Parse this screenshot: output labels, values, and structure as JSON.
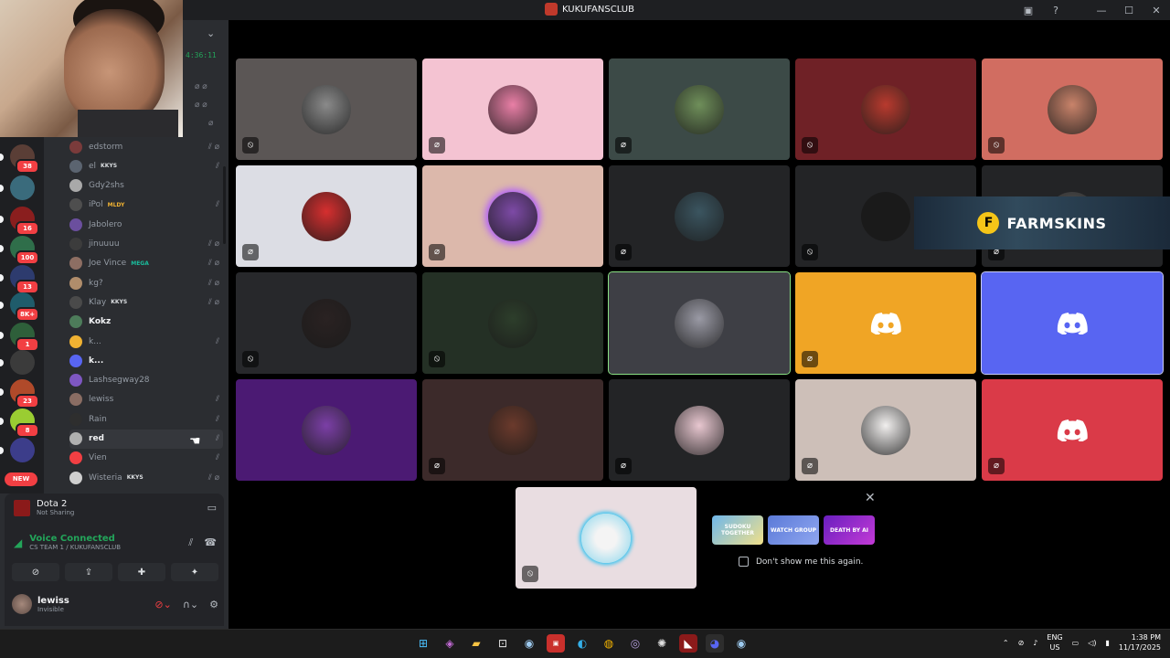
{
  "window": {
    "title": "KUKUFANSCLUB"
  },
  "timer": "4:36:11",
  "servers": [
    {
      "badge": "38",
      "color": "#5a3e36"
    },
    {
      "badge": "",
      "color": "#3a6b7c"
    },
    {
      "badge": "16",
      "color": "#8a1e1e"
    },
    {
      "badge": "100",
      "color": "#2f6e4a"
    },
    {
      "badge": "13",
      "color": "#2d3b6e"
    },
    {
      "badge": "8K+",
      "color": "#1f5c6b"
    },
    {
      "badge": "1",
      "color": "#2e5f3a"
    },
    {
      "badge": "",
      "color": "#3b3b3b"
    },
    {
      "badge": "23",
      "color": "#b04a2a"
    },
    {
      "badge": "8",
      "color": "#9acd32"
    },
    {
      "badge": "",
      "color": "#3c3d8a"
    }
  ],
  "new_label": "NEW",
  "members": [
    {
      "name": "edstorm",
      "tag": "",
      "bold": false,
      "color": "#7a3b3b"
    },
    {
      "name": "el",
      "tag": "KKYS",
      "bold": false,
      "color": "#5b6470"
    },
    {
      "name": "Gdy2shs",
      "tag": "",
      "bold": false,
      "color": "#a9a9a9"
    },
    {
      "name": "iPol",
      "tag": "MLDY",
      "bold": false,
      "color": "#4e4e4e"
    },
    {
      "name": "Jabolero",
      "tag": "",
      "bold": false,
      "color": "#6b4f9e"
    },
    {
      "name": "jinuuuu",
      "tag": "",
      "bold": false,
      "color": "#3c3c3c"
    },
    {
      "name": "Joe Vince",
      "tag": "MEGA",
      "bold": false,
      "color": "#8d6e63"
    },
    {
      "name": "kg?",
      "tag": "",
      "bold": false,
      "color": "#b08d6b"
    },
    {
      "name": "Klay",
      "tag": "KKYS",
      "bold": false,
      "color": "#4a4a4a"
    },
    {
      "name": "Kokz",
      "tag": "",
      "bold": true,
      "color": "#4d7c5a"
    },
    {
      "name": "k...",
      "tag": "",
      "bold": false,
      "color": "#f0b232"
    },
    {
      "name": "k...",
      "tag": "",
      "bold": true,
      "color": "#5865f2"
    },
    {
      "name": "Lashsegway28",
      "tag": "",
      "bold": false,
      "color": "#7e57c2"
    },
    {
      "name": "lewiss",
      "tag": "",
      "bold": false,
      "color": "#8a6d63"
    },
    {
      "name": "Rain",
      "tag": "",
      "bold": false,
      "color": "#2e2e2e"
    },
    {
      "name": "red",
      "tag": "",
      "bold": true,
      "color": "#b0b0b0"
    },
    {
      "name": "Vien",
      "tag": "",
      "bold": false,
      "color": "#f23f43"
    },
    {
      "name": "Wisteria",
      "tag": "KKYS",
      "bold": false,
      "color": "#cfcfcf"
    }
  ],
  "activity": {
    "game": "Dota 2",
    "status": "Not Sharing"
  },
  "voice": {
    "status": "Voice Connected",
    "channel": "CS TEAM 1 / KUKUFANSCLUB"
  },
  "user": {
    "name": "lewiss",
    "status": "Invisible"
  },
  "tiles": [
    {
      "bg": "#5b5655",
      "avatar": "#8a8a8a"
    },
    {
      "bg": "#f4c3d2",
      "avatar": "#e97fa6"
    },
    {
      "bg": "#3c4a47",
      "avatar": "#6f8f5a"
    },
    {
      "bg": "#6f2126",
      "avatar": "#b83a2e"
    },
    {
      "bg": "#d16d61",
      "avatar": "#c9836a"
    },
    {
      "bg": "#dcdde4",
      "avatar": "#d62f2f"
    },
    {
      "bg": "#dcb8ab",
      "avatar": "#7d4aa6"
    },
    {
      "bg": "#232426",
      "avatar": "#3b5560"
    },
    {
      "bg": "#232426",
      "avatar": "#1a1a1a"
    },
    {
      "bg": "#232426",
      "avatar": "#555"
    },
    {
      "bg": "#27282b",
      "avatar": "#2a2222"
    },
    {
      "bg": "#243025",
      "avatar": "#2d3e2b"
    },
    {
      "bg": "#3e3f45",
      "avatar": "#9a9aa5"
    },
    {
      "bg": "#f0a525",
      "avatar": ""
    },
    {
      "bg": "#5865f2",
      "avatar": ""
    },
    {
      "bg": "#4b1a73",
      "avatar": "#7b3fa6"
    },
    {
      "bg": "#3c2a2a",
      "avatar": "#6b3a2c"
    },
    {
      "bg": "#232426",
      "avatar": "#e8c7d0"
    },
    {
      "bg": "#cdbfb8",
      "avatar": "#f1efee"
    },
    {
      "bg": "#da3a48",
      "avatar": ""
    }
  ],
  "focus_tile": {
    "bg": "#e9dde1",
    "avatar": "#b6e3f0"
  },
  "ad": {
    "text": "FARMSKINS"
  },
  "promo": {
    "games": [
      "SUDOKU TOGETHER",
      "WATCH GROUP",
      "DEATH BY AI"
    ],
    "dont_show": "Don't show me this again."
  },
  "taskbar": {
    "lang": "ENG",
    "region": "US",
    "time": "1:38 PM",
    "date": "11/17/2025"
  }
}
